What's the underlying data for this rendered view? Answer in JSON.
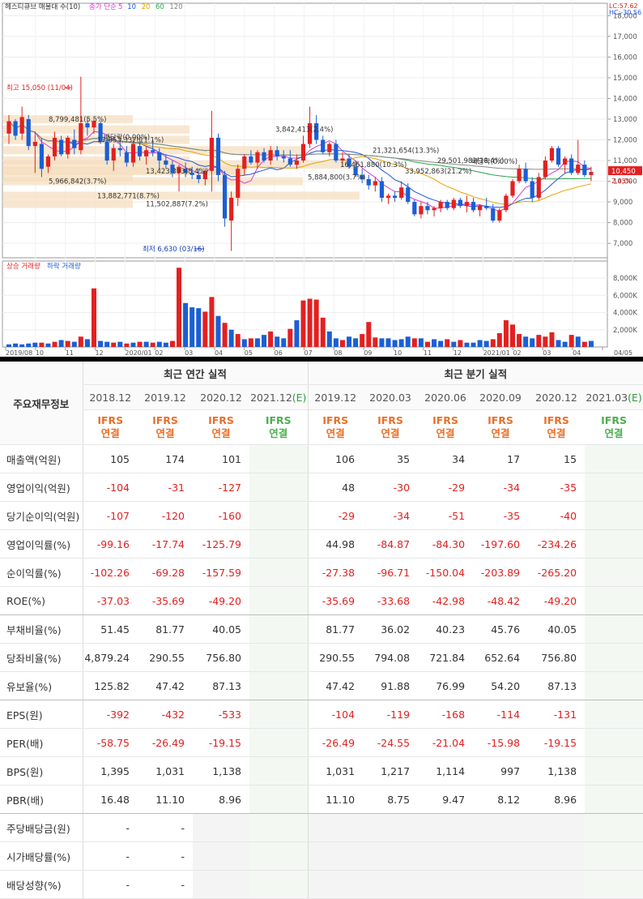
{
  "chart": {
    "legend_items": [
      {
        "text": "헤스티큐브 매물대 수(10)",
        "color": "#333333"
      },
      {
        "text": "종가 단순",
        "color": "#d63cd6"
      },
      {
        "text": "5",
        "color": "#d63cd6"
      },
      {
        "text": "10",
        "color": "#2255dd"
      },
      {
        "text": "20",
        "color": "#e0a400"
      },
      {
        "text": "60",
        "color": "#2aa24a"
      },
      {
        "text": "120",
        "color": "#888888"
      }
    ],
    "corner_labels": {
      "lc": "LC:57.62",
      "hc": "HC:-30.56"
    },
    "annotations": {
      "high": "최고 15,050 (11/04)",
      "low": "최저 6,630 (03/16)",
      "dividend_1": "배당락(0.00%)",
      "dividend_2": "배당락(0.00%)"
    },
    "volume_legend": {
      "up": "상승 거래량",
      "down": "하락 거래량"
    },
    "volume_ticks": [
      "8,000K",
      "6,000K",
      "4,000K",
      "2,000K"
    ],
    "current_price": "10,450",
    "current_change": "2.45%",
    "colors": {
      "up": "#e32020",
      "down": "#1a5fd6",
      "band": "#f6dfc0",
      "current": "#e32020"
    }
  },
  "chart_data": {
    "type": "candlestick",
    "title": "헤스티큐브 매물대 수(10)",
    "y_ticks": [
      18000,
      17000,
      16000,
      15000,
      14000,
      13000,
      12000,
      11000,
      10000,
      9000,
      8000,
      7000
    ],
    "y_tick_labels": [
      "18,000",
      "17,000",
      "16,000",
      "15,000",
      "14,000",
      "13,000",
      "12,000",
      "11,000",
      "10,000",
      "9,000",
      "8,000",
      "7,000"
    ],
    "ylim": [
      6300,
      18600
    ],
    "x_labels": [
      "2019/08",
      "10",
      "11",
      "12",
      "2020/01",
      "02",
      "03",
      "04",
      "05",
      "06",
      "07",
      "08",
      "09",
      "10",
      "11",
      "12",
      "2021/01",
      "02",
      "03",
      "04",
      "04/05"
    ],
    "volume_profile": [
      {
        "label": "8,799,481(5.5%)",
        "price": 13000
      },
      {
        "label": "17,853,337(11.1%)",
        "price": 12000
      },
      {
        "label": "13,423,393(8.4%)",
        "price": 10500
      },
      {
        "label": "5,966,842(3.7%)",
        "price": 10000
      },
      {
        "label": "13,882,771(8.7%)",
        "price": 9300
      },
      {
        "label": "11,502,887(7.2%)",
        "price": 8900
      },
      {
        "label": "29,501,982(18.4%)",
        "price": 11000
      },
      {
        "label": "33,952,863(21.2%)",
        "price": 10500
      },
      {
        "label": "21,321,654(13.3%)",
        "price": 11500
      },
      {
        "label": "16,461,880(10.3%)",
        "price": 10800
      },
      {
        "label": "5,884,800(3.7%)",
        "price": 10200
      },
      {
        "label": "3,842,413(2.4%)",
        "price": 12500
      }
    ],
    "candles": [
      [
        12300,
        13200,
        11800,
        12900
      ],
      [
        12900,
        13000,
        12000,
        12200
      ],
      [
        12300,
        13600,
        12000,
        13100
      ],
      [
        13000,
        13200,
        11500,
        11700
      ],
      [
        11700,
        12400,
        10400,
        11900
      ],
      [
        11800,
        12100,
        10200,
        10600
      ],
      [
        10700,
        11300,
        10400,
        11200
      ],
      [
        11200,
        12400,
        11000,
        12100
      ],
      [
        12000,
        12200,
        11200,
        11300
      ],
      [
        11300,
        12200,
        11100,
        12100
      ],
      [
        12000,
        12500,
        11300,
        11600
      ],
      [
        11500,
        15050,
        11300,
        12800
      ],
      [
        12800,
        13100,
        12200,
        12600
      ],
      [
        12600,
        13000,
        12300,
        12900
      ],
      [
        12800,
        12900,
        11800,
        11900
      ],
      [
        11900,
        12100,
        10800,
        11000
      ],
      [
        11000,
        11800,
        10500,
        11600
      ],
      [
        11600,
        12000,
        11200,
        11500
      ],
      [
        11400,
        11700,
        10700,
        10900
      ],
      [
        10900,
        12000,
        10700,
        11800
      ],
      [
        11700,
        12100,
        11000,
        11200
      ],
      [
        11200,
        11700,
        10800,
        11500
      ],
      [
        11500,
        12000,
        11200,
        11400
      ],
      [
        11400,
        11600,
        10600,
        11000
      ],
      [
        11000,
        11300,
        10600,
        10800
      ],
      [
        10800,
        11000,
        10200,
        10400
      ],
      [
        10400,
        10800,
        9500,
        10700
      ],
      [
        10600,
        10900,
        10200,
        10400
      ],
      [
        10400,
        10700,
        10100,
        10300
      ],
      [
        10300,
        10600,
        9900,
        10100
      ],
      [
        10100,
        10600,
        9800,
        10500
      ],
      [
        10500,
        13400,
        9500,
        12100
      ],
      [
        12100,
        12300,
        10000,
        10300
      ],
      [
        10300,
        10500,
        7800,
        8200
      ],
      [
        8100,
        9500,
        6630,
        9200
      ],
      [
        9200,
        10800,
        8800,
        10600
      ],
      [
        10600,
        11300,
        10300,
        11200
      ],
      [
        11200,
        11500,
        10800,
        10900
      ],
      [
        10900,
        11500,
        10600,
        11400
      ],
      [
        11400,
        11600,
        10900,
        11000
      ],
      [
        11000,
        11700,
        10800,
        11500
      ],
      [
        11500,
        11700,
        11000,
        11200
      ],
      [
        11200,
        11500,
        10900,
        11100
      ],
      [
        11100,
        11500,
        10700,
        10800
      ],
      [
        10800,
        11300,
        10600,
        11000
      ],
      [
        11000,
        12200,
        10900,
        11800
      ],
      [
        11800,
        13600,
        11600,
        12800
      ],
      [
        12800,
        13200,
        11800,
        12000
      ],
      [
        12000,
        12200,
        11300,
        11400
      ],
      [
        11400,
        11900,
        11200,
        11800
      ],
      [
        11800,
        12000,
        10900,
        11000
      ],
      [
        11000,
        11400,
        10700,
        11100
      ],
      [
        11100,
        11300,
        10600,
        10700
      ],
      [
        10700,
        11000,
        10200,
        10300
      ],
      [
        10300,
        10600,
        9900,
        10100
      ],
      [
        10100,
        10300,
        9600,
        9800
      ],
      [
        9800,
        10200,
        9500,
        10000
      ],
      [
        10000,
        10200,
        9000,
        9200
      ],
      [
        9200,
        9400,
        8900,
        9300
      ],
      [
        9300,
        9500,
        9000,
        9200
      ],
      [
        9200,
        10000,
        9100,
        9700
      ],
      [
        9700,
        9900,
        8900,
        9000
      ],
      [
        9000,
        9100,
        8300,
        8400
      ],
      [
        8400,
        9000,
        8200,
        8800
      ],
      [
        8800,
        9000,
        8400,
        8600
      ],
      [
        8600,
        8800,
        8300,
        8700
      ],
      [
        8700,
        9100,
        8500,
        9000
      ],
      [
        9000,
        9100,
        8600,
        8700
      ],
      [
        8700,
        9200,
        8600,
        9100
      ],
      [
        9100,
        9200,
        8700,
        8800
      ],
      [
        8800,
        9300,
        8500,
        9000
      ],
      [
        9000,
        9200,
        8500,
        8600
      ],
      [
        8600,
        8900,
        8300,
        8800
      ],
      [
        8800,
        9200,
        8600,
        8700
      ],
      [
        8700,
        8900,
        8000,
        8100
      ],
      [
        8100,
        8700,
        8000,
        8600
      ],
      [
        8600,
        9400,
        8500,
        9300
      ],
      [
        9300,
        10100,
        9200,
        10000
      ],
      [
        10000,
        10800,
        9900,
        10600
      ],
      [
        10600,
        10900,
        9900,
        10000
      ],
      [
        10000,
        10200,
        9000,
        9200
      ],
      [
        9200,
        10400,
        9100,
        10200
      ],
      [
        10200,
        11200,
        10100,
        11000
      ],
      [
        11000,
        11700,
        10900,
        11600
      ],
      [
        11600,
        11700,
        10700,
        10800
      ],
      [
        10800,
        11200,
        10400,
        11100
      ],
      [
        11100,
        11300,
        10300,
        10400
      ],
      [
        10400,
        12000,
        10300,
        10800
      ],
      [
        10800,
        11000,
        10200,
        10300
      ],
      [
        10300,
        10700,
        10000,
        10450
      ]
    ],
    "volumes": [
      [
        0.3,
        0
      ],
      [
        0.4,
        0
      ],
      [
        0.3,
        0
      ],
      [
        0.4,
        0
      ],
      [
        0.5,
        0
      ],
      [
        0.5,
        1
      ],
      [
        0.4,
        0
      ],
      [
        0.6,
        1
      ],
      [
        0.8,
        0
      ],
      [
        0.7,
        1
      ],
      [
        0.6,
        0
      ],
      [
        1.2,
        1
      ],
      [
        0.9,
        0
      ],
      [
        6.8,
        1
      ],
      [
        0.7,
        0
      ],
      [
        0.6,
        0
      ],
      [
        0.5,
        1
      ],
      [
        0.6,
        0
      ],
      [
        0.4,
        1
      ],
      [
        0.5,
        0
      ],
      [
        0.6,
        1
      ],
      [
        0.6,
        0
      ],
      [
        0.5,
        1
      ],
      [
        0.6,
        0
      ],
      [
        0.5,
        0
      ],
      [
        0.7,
        1
      ],
      [
        9.2,
        1
      ],
      [
        5.1,
        0
      ],
      [
        4.6,
        0
      ],
      [
        4.5,
        0
      ],
      [
        4.1,
        1
      ],
      [
        5.8,
        1
      ],
      [
        3.6,
        0
      ],
      [
        2.8,
        1
      ],
      [
        2.0,
        0
      ],
      [
        1.5,
        1
      ],
      [
        0.9,
        0
      ],
      [
        1.0,
        1
      ],
      [
        1.0,
        0
      ],
      [
        1.4,
        0
      ],
      [
        1.8,
        1
      ],
      [
        1.2,
        0
      ],
      [
        1.0,
        0
      ],
      [
        2.1,
        1
      ],
      [
        3.1,
        0
      ],
      [
        5.4,
        1
      ],
      [
        5.6,
        1
      ],
      [
        5.5,
        1
      ],
      [
        3.4,
        1
      ],
      [
        1.8,
        0
      ],
      [
        1.0,
        0
      ],
      [
        0.8,
        1
      ],
      [
        1.2,
        0
      ],
      [
        1.0,
        0
      ],
      [
        1.5,
        1
      ],
      [
        2.9,
        1
      ],
      [
        1.1,
        1
      ],
      [
        1.0,
        0
      ],
      [
        1.0,
        0
      ],
      [
        0.8,
        0
      ],
      [
        0.9,
        0
      ],
      [
        1.2,
        0
      ],
      [
        1.0,
        1
      ],
      [
        1.0,
        0
      ],
      [
        0.6,
        1
      ],
      [
        0.9,
        0
      ],
      [
        0.7,
        0
      ],
      [
        0.9,
        1
      ],
      [
        0.6,
        0
      ],
      [
        0.8,
        1
      ],
      [
        0.5,
        0
      ],
      [
        0.5,
        0
      ],
      [
        0.8,
        0
      ],
      [
        0.7,
        0
      ],
      [
        0.9,
        1
      ],
      [
        1.6,
        1
      ],
      [
        3.1,
        1
      ],
      [
        2.6,
        1
      ],
      [
        1.5,
        1
      ],
      [
        1.2,
        0
      ],
      [
        1.0,
        0
      ],
      [
        1.4,
        1
      ],
      [
        1.2,
        1
      ],
      [
        1.7,
        1
      ],
      [
        0.8,
        0
      ],
      [
        0.6,
        0
      ],
      [
        1.4,
        1
      ],
      [
        1.2,
        0
      ],
      [
        0.6,
        1
      ],
      [
        0.7,
        0
      ]
    ]
  },
  "table": {
    "row_header_title": "주요재무정보",
    "group_annual": "최근 연간 실적",
    "group_quarterly": "최근 분기 실적",
    "periods": [
      {
        "label": "2018.12",
        "est": false
      },
      {
        "label": "2019.12",
        "est": false
      },
      {
        "label": "2020.12",
        "est": false
      },
      {
        "label": "2021.12",
        "est_suffix": "(E)",
        "est": true
      },
      {
        "label": "2019.12",
        "est": false
      },
      {
        "label": "2020.03",
        "est": false
      },
      {
        "label": "2020.06",
        "est": false
      },
      {
        "label": "2020.09",
        "est": false
      },
      {
        "label": "2020.12",
        "est": false
      },
      {
        "label": "2021.03",
        "est_suffix": "(E)",
        "est": true
      }
    ],
    "ifrs_top": "IFRS",
    "ifrs_bottom": "연결",
    "rows": [
      {
        "label": "매출액(억원)",
        "values": [
          "105",
          "174",
          "101",
          "",
          "106",
          "35",
          "34",
          "17",
          "15",
          ""
        ]
      },
      {
        "label": "영업이익(억원)",
        "values": [
          "-104",
          "-31",
          "-127",
          "",
          "48",
          "-30",
          "-29",
          "-34",
          "-35",
          ""
        ]
      },
      {
        "label": "당기순이익(억원)",
        "values": [
          "-107",
          "-120",
          "-160",
          "",
          "-29",
          "-34",
          "-51",
          "-35",
          "-40",
          ""
        ]
      },
      {
        "label": "영업이익률(%)",
        "values": [
          "-99.16",
          "-17.74",
          "-125.79",
          "",
          "44.98",
          "-84.87",
          "-84.30",
          "-197.60",
          "-234.26",
          ""
        ]
      },
      {
        "label": "순이익률(%)",
        "values": [
          "-102.26",
          "-69.28",
          "-157.59",
          "",
          "-27.38",
          "-96.71",
          "-150.04",
          "-203.89",
          "-265.20",
          ""
        ]
      },
      {
        "label": "ROE(%)",
        "values": [
          "-37.03",
          "-35.69",
          "-49.20",
          "",
          "-35.69",
          "-33.68",
          "-42.98",
          "-48.42",
          "-49.20",
          ""
        ]
      },
      {
        "label": "부채비율(%)",
        "values": [
          "51.45",
          "81.77",
          "40.05",
          "",
          "81.77",
          "36.02",
          "40.23",
          "45.76",
          "40.05",
          ""
        ]
      },
      {
        "label": "당좌비율(%)",
        "values": [
          "4,879.24",
          "290.55",
          "756.80",
          "",
          "290.55",
          "794.08",
          "721.84",
          "652.64",
          "756.80",
          ""
        ]
      },
      {
        "label": "유보율(%)",
        "values": [
          "125.82",
          "47.42",
          "87.13",
          "",
          "47.42",
          "91.88",
          "76.99",
          "54.20",
          "87.13",
          ""
        ]
      },
      {
        "label": "EPS(원)",
        "values": [
          "-392",
          "-432",
          "-533",
          "",
          "-104",
          "-119",
          "-168",
          "-114",
          "-131",
          ""
        ]
      },
      {
        "label": "PER(배)",
        "values": [
          "-58.75",
          "-26.49",
          "-19.15",
          "",
          "-26.49",
          "-24.55",
          "-21.04",
          "-15.98",
          "-19.15",
          ""
        ]
      },
      {
        "label": "BPS(원)",
        "values": [
          "1,395",
          "1,031",
          "1,138",
          "",
          "1,031",
          "1,217",
          "1,114",
          "997",
          "1,138",
          ""
        ]
      },
      {
        "label": "PBR(배)",
        "values": [
          "16.48",
          "11.10",
          "8.96",
          "",
          "11.10",
          "8.75",
          "9.47",
          "8.12",
          "8.96",
          ""
        ]
      },
      {
        "label": "주당배당금(원)",
        "values": [
          "-",
          "-",
          "",
          "",
          "",
          "",
          "",
          "",
          "",
          ""
        ]
      },
      {
        "label": "시가배당률(%)",
        "values": [
          "-",
          "-",
          "",
          "",
          "",
          "",
          "",
          "",
          "",
          ""
        ]
      },
      {
        "label": "배당성향(%)",
        "values": [
          "-",
          "-",
          "",
          "",
          "",
          "",
          "",
          "",
          "",
          ""
        ]
      }
    ]
  }
}
